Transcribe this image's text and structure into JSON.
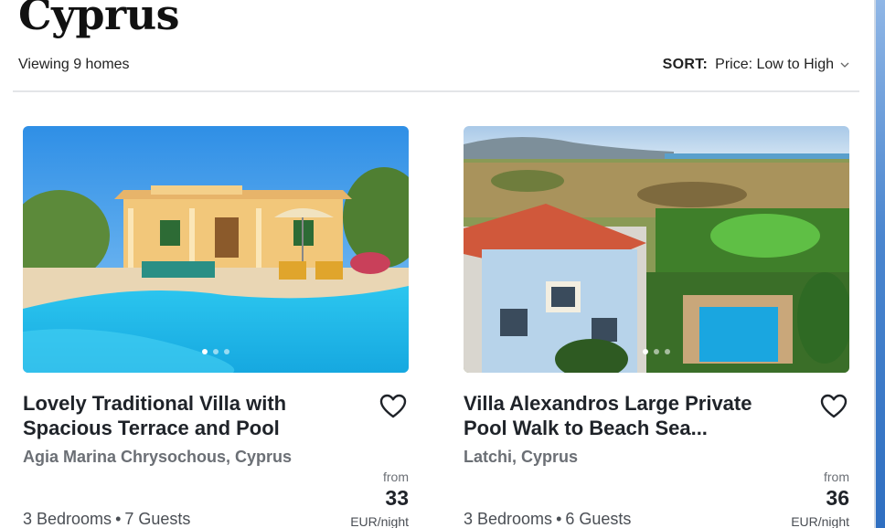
{
  "page": {
    "title": "Cyprus",
    "viewing": "Viewing 9 homes",
    "sort_label": "SORT:",
    "sort_value": "Price: Low to High"
  },
  "listings": [
    {
      "title": "Lovely Traditional Villa with Spacious Terrace and Pool",
      "location": "Agia Marina Chrysochous, Cyprus",
      "price_prefix": "from",
      "price": "33",
      "price_unit": "EUR/night",
      "bedrooms": "3 Bedrooms",
      "separator": "•",
      "guests": "7 Guests"
    },
    {
      "title": "Villa Alexandros  Large Private Pool  Walk to Beach  Sea...",
      "location": "Latchi, Cyprus",
      "price_prefix": "from",
      "price": "36",
      "price_unit": "EUR/night",
      "bedrooms": "3 Bedrooms",
      "separator": "•",
      "guests": "6 Guests"
    }
  ],
  "icons": {
    "favorite": "heart-outline-icon",
    "sort": "chevron-down-icon"
  }
}
